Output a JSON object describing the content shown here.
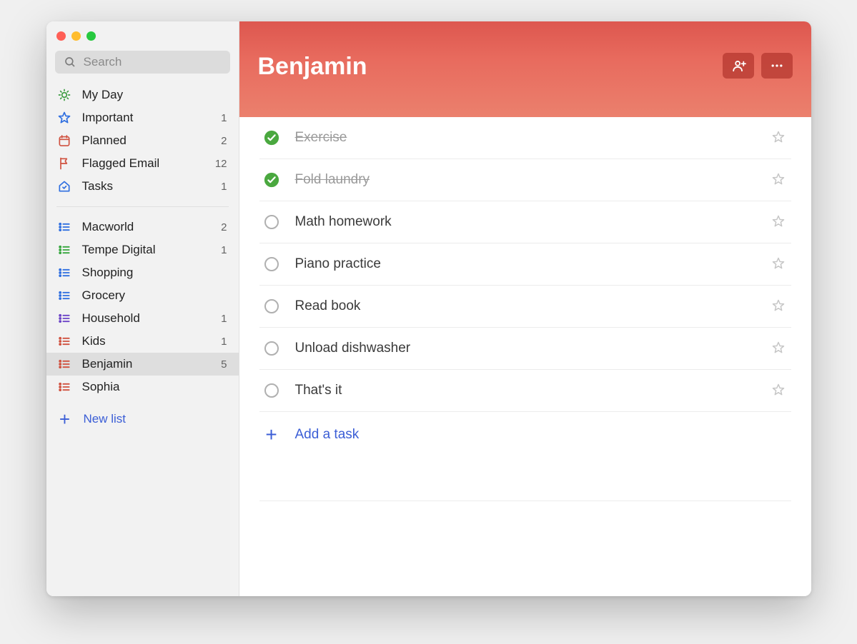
{
  "search": {
    "placeholder": "Search"
  },
  "smart_lists": [
    {
      "id": "myday",
      "label": "My Day"
    },
    {
      "id": "important",
      "label": "Important",
      "count": 1
    },
    {
      "id": "planned",
      "label": "Planned",
      "count": 2
    },
    {
      "id": "flagged",
      "label": "Flagged Email",
      "count": 12
    },
    {
      "id": "tasks",
      "label": "Tasks",
      "count": 1
    }
  ],
  "custom_lists": [
    {
      "id": "macworld",
      "label": "Macworld",
      "count": 2,
      "color": "#2f6fe0"
    },
    {
      "id": "tempe",
      "label": "Tempe Digital",
      "count": 1,
      "color": "#35a63d"
    },
    {
      "id": "shopping",
      "label": "Shopping",
      "color": "#2f6fe0"
    },
    {
      "id": "grocery",
      "label": "Grocery",
      "color": "#2f6fe0"
    },
    {
      "id": "household",
      "label": "Household",
      "count": 1,
      "color": "#6b43c7"
    },
    {
      "id": "kids",
      "label": "Kids",
      "count": 1,
      "color": "#d0513f"
    },
    {
      "id": "benjamin",
      "label": "Benjamin",
      "count": 5,
      "color": "#d0513f",
      "selected": true
    },
    {
      "id": "sophia",
      "label": "Sophia",
      "color": "#d0513f"
    }
  ],
  "new_list_label": "New list",
  "header": {
    "title": "Benjamin",
    "accent": "#e0645a"
  },
  "tasks": [
    {
      "title": "Exercise",
      "completed": true
    },
    {
      "title": "Fold laundry",
      "completed": true
    },
    {
      "title": "Math homework",
      "completed": false
    },
    {
      "title": "Piano practice",
      "completed": false
    },
    {
      "title": "Read book",
      "completed": false
    },
    {
      "title": "Unload dishwasher",
      "completed": false
    },
    {
      "title": "That's it",
      "completed": false
    }
  ],
  "add_task_label": "Add a task"
}
